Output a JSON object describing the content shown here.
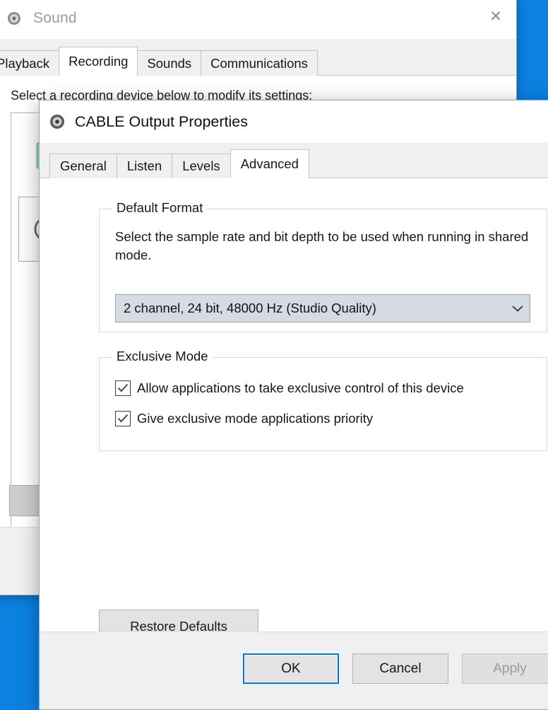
{
  "desktop": {
    "background_color": "#0c81e0"
  },
  "sound_window": {
    "title": "Sound",
    "icon": "speaker-icon",
    "close_label": "✕",
    "tabs": [
      {
        "label": "Playback",
        "active": false
      },
      {
        "label": "Recording",
        "active": true
      },
      {
        "label": "Sounds",
        "active": false
      },
      {
        "label": "Communications",
        "active": false
      }
    ],
    "hint": "Select a recording device below to modify its settings:",
    "devices": [
      {
        "icon": "line-in-jack-icon",
        "selected": false
      },
      {
        "icon": "headset-microphone-icon",
        "selected": true
      }
    ]
  },
  "properties_dialog": {
    "title": "CABLE Output Properties",
    "icon": "speaker-icon",
    "close_label": "✕",
    "tabs": [
      {
        "label": "General",
        "active": false
      },
      {
        "label": "Listen",
        "active": false
      },
      {
        "label": "Levels",
        "active": false
      },
      {
        "label": "Advanced",
        "active": true
      }
    ],
    "default_format": {
      "group_title": "Default Format",
      "description": "Select the sample rate and bit depth to be used when running in shared mode.",
      "selected_value": "2 channel, 24 bit, 48000 Hz (Studio Quality)",
      "dropdown_arrow": "chevron-down-icon"
    },
    "exclusive_mode": {
      "group_title": "Exclusive Mode",
      "checkboxes": [
        {
          "label": "Allow applications to take exclusive control of this device",
          "checked": true
        },
        {
          "label": "Give exclusive mode applications priority",
          "checked": true
        }
      ]
    },
    "restore_defaults_label": "Restore Defaults",
    "buttons": {
      "ok": "OK",
      "cancel": "Cancel",
      "apply": "Apply",
      "apply_enabled": false,
      "focus_color": "#0078d7"
    }
  }
}
